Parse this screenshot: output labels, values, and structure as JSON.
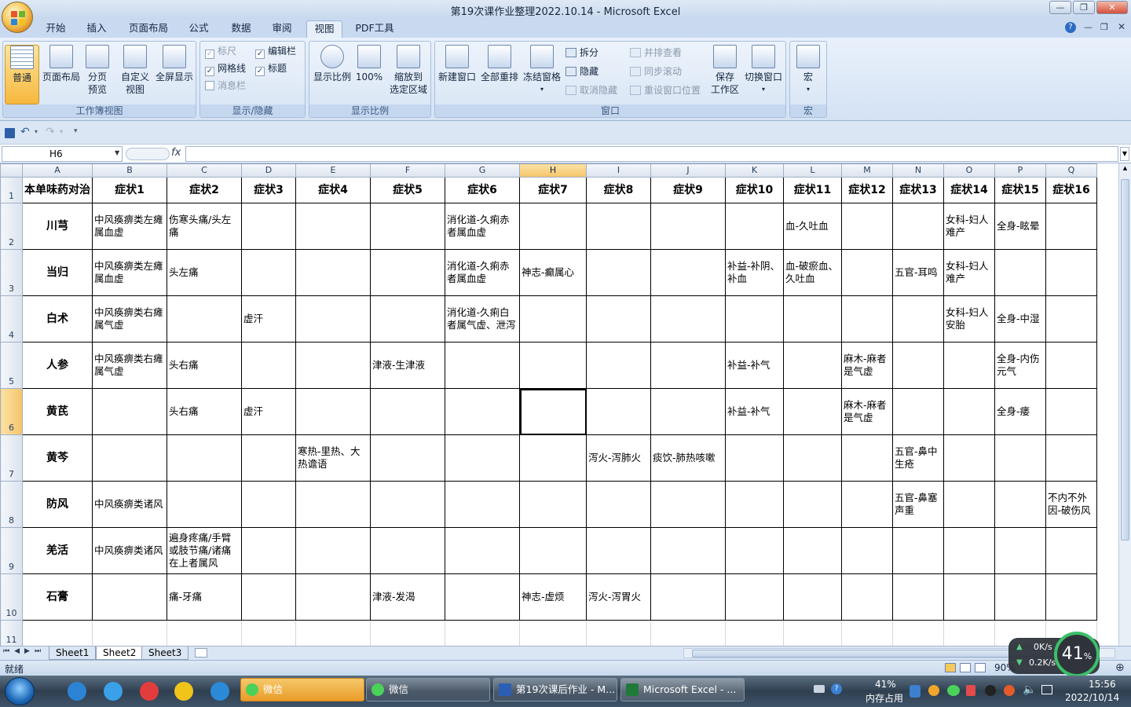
{
  "window": {
    "title": "第19次课作业整理2022.10.14 - Microsoft Excel"
  },
  "tabs": [
    "开始",
    "插入",
    "页面布局",
    "公式",
    "数据",
    "审阅",
    "视图",
    "PDF工具"
  ],
  "active_tab": "视图",
  "ribbon": {
    "workbook_views": {
      "label": "工作簿视图",
      "normal": "普通",
      "page_layout": "页面布局",
      "page_break": "分页\n预览",
      "custom": "自定义\n视图",
      "full_screen": "全屏显示"
    },
    "show_hide": {
      "label": "显示/隐藏",
      "ruler": "标尺",
      "gridlines": "网格线",
      "message_bar": "消息栏",
      "formula_bar": "编辑栏",
      "headings": "标题"
    },
    "zoom": {
      "label": "显示比例",
      "zoom": "显示比例",
      "hundred": "100%",
      "zoom_selection": "缩放到\n选定区域"
    },
    "window": {
      "label": "窗口",
      "new_window": "新建窗口",
      "arrange_all": "全部重排",
      "freeze": "冻结窗格",
      "split": "拆分",
      "hide": "隐藏",
      "unhide": "取消隐藏",
      "side_by_side": "并排查看",
      "sync_scroll": "同步滚动",
      "reset_pos": "重设窗口位置",
      "save_ws": "保存\n工作区",
      "switch": "切换窗口"
    },
    "macros": {
      "label": "宏",
      "macros": "宏"
    }
  },
  "formula_bar": {
    "name_box": "H6",
    "fx": "fx",
    "value": ""
  },
  "columns": [
    "A",
    "B",
    "C",
    "D",
    "E",
    "F",
    "G",
    "H",
    "I",
    "J",
    "K",
    "L",
    "M",
    "N",
    "O",
    "P",
    "Q"
  ],
  "selected_column": "H",
  "selected_row": "6",
  "rows": [
    {
      "n": "1",
      "cells": [
        "本单味药对治",
        "症状1",
        "症状2",
        "症状3",
        "症状4",
        "症状5",
        "症状6",
        "症状7",
        "症状8",
        "症状9",
        "症状10",
        "症状11",
        "症状12",
        "症状13",
        "症状14",
        "症状15",
        "症状16"
      ]
    },
    {
      "n": "2",
      "cells": [
        "川芎",
        "中风痪痹类左瘫属血虚",
        "伤寒头痛/头左痛",
        "",
        "",
        "",
        "消化道-久痢赤者属血虚",
        "",
        "",
        "",
        "",
        "血-久吐血",
        "",
        "",
        "女科-妇人难产",
        "全身-眩晕",
        ""
      ]
    },
    {
      "n": "3",
      "cells": [
        "当归",
        "中风痪痹类左瘫属血虚",
        "头左痛",
        "",
        "",
        "",
        "消化道-久痢赤者属血虚",
        "神志-癫属心",
        "",
        "",
        "补益-补阴、补血",
        "血-破瘀血、久吐血",
        "",
        "五官-耳鸣",
        "女科-妇人难产",
        "",
        ""
      ]
    },
    {
      "n": "4",
      "cells": [
        "白术",
        "中风痪痹类右瘫属气虚",
        "",
        "虚汗",
        "",
        "",
        "消化道-久痢白者属气虚、泄泻",
        "",
        "",
        "",
        "",
        "",
        "",
        "",
        "女科-妇人安胎",
        "全身-中湿",
        ""
      ]
    },
    {
      "n": "5",
      "cells": [
        "人参",
        "中风痪痹类右瘫属气虚",
        "头右痛",
        "",
        "",
        "津液-生津液",
        "",
        "",
        "",
        "",
        "补益-补气",
        "",
        "麻木-麻者是气虚",
        "",
        "",
        "全身-内伤元气",
        ""
      ]
    },
    {
      "n": "6",
      "cells": [
        "黄芪",
        "",
        "头右痛",
        "虚汗",
        "",
        "",
        "",
        "",
        "",
        "",
        "补益-补气",
        "",
        "麻木-麻者是气虚",
        "",
        "",
        "全身-痿",
        ""
      ]
    },
    {
      "n": "7",
      "cells": [
        "黄芩",
        "",
        "",
        "",
        "寒热-里热、大热谵语",
        "",
        "",
        "",
        "泻火-泻肺火",
        "痰饮-肺热咳嗽",
        "",
        "",
        "",
        "五官-鼻中生疮",
        "",
        "",
        ""
      ]
    },
    {
      "n": "8",
      "cells": [
        "防风",
        "中风痪痹类诸风",
        "",
        "",
        "",
        "",
        "",
        "",
        "",
        "",
        "",
        "",
        "",
        "五官-鼻塞声重",
        "",
        "",
        "不内不外因-破伤风"
      ]
    },
    {
      "n": "9",
      "cells": [
        "羌活",
        "中风痪痹类诸风",
        "遍身疼痛/手臂或肢节痛/诸痛在上者属风",
        "",
        "",
        "",
        "",
        "",
        "",
        "",
        "",
        "",
        "",
        "",
        "",
        "",
        ""
      ]
    },
    {
      "n": "10",
      "cells": [
        "石膏",
        "",
        "痛-牙痛",
        "",
        "",
        "津液-发渴",
        "",
        "神志-虚烦",
        "泻火-泻胃火",
        "",
        "",
        "",
        "",
        "",
        "",
        "",
        ""
      ]
    },
    {
      "n": "11",
      "cells": [
        "",
        "",
        "",
        "",
        "",
        "",
        "",
        "",
        "",
        "",
        "",
        "",
        "",
        "",
        "",
        "",
        ""
      ]
    }
  ],
  "sheets": [
    "Sheet1",
    "Sheet2",
    "Sheet3"
  ],
  "active_sheet": "Sheet2",
  "status": {
    "ready": "就绪",
    "zoom": "90%"
  },
  "net": {
    "up": "0K/s",
    "down": "0.2K/s",
    "mem": "41",
    "mem_unit": "%"
  },
  "taskbar": {
    "apps": [
      "微信",
      "微信",
      "第19次课后作业 - M...",
      "Microsoft Excel - ..."
    ],
    "mem_pct": "41%",
    "mem_label": "内存占用",
    "time": "15:56",
    "date": "2022/10/14"
  }
}
